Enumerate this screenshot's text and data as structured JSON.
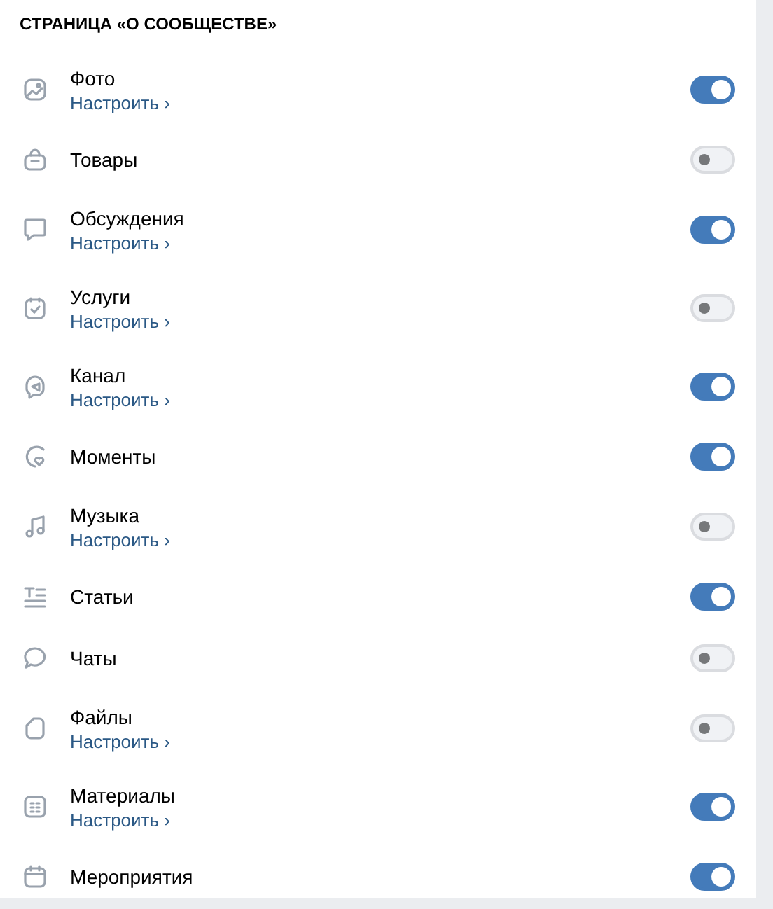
{
  "section_title": "СТРАНИЦА «О СООБЩЕСТВЕ»",
  "items": [
    {
      "label": "Фото",
      "link": "Настроить ›",
      "on": true
    },
    {
      "label": "Товары",
      "on": false
    },
    {
      "label": "Обсуждения",
      "link": "Настроить ›",
      "on": true
    },
    {
      "label": "Услуги",
      "link": "Настроить ›",
      "on": false
    },
    {
      "label": "Канал",
      "link": "Настроить ›",
      "on": true
    },
    {
      "label": "Моменты",
      "on": true
    },
    {
      "label": "Музыка",
      "link": "Настроить ›",
      "on": false
    },
    {
      "label": "Статьи",
      "on": true
    },
    {
      "label": "Чаты",
      "on": false
    },
    {
      "label": "Файлы",
      "link": "Настроить ›",
      "on": false
    },
    {
      "label": "Материалы",
      "link": "Настроить ›",
      "on": true
    },
    {
      "label": "Мероприятия",
      "on": true
    }
  ]
}
